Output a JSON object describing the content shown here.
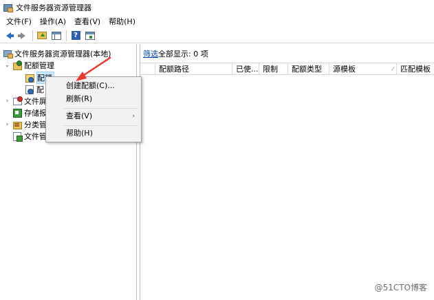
{
  "window": {
    "title": "文件服务器资源管理器"
  },
  "menubar": [
    {
      "label": "文件(F)"
    },
    {
      "label": "操作(A)"
    },
    {
      "label": "查看(V)"
    },
    {
      "label": "帮助(H)"
    }
  ],
  "toolbar": {
    "icons": [
      "back-arrow-icon",
      "forward-arrow-icon",
      "up-folder-icon",
      "show-hide-tree-icon",
      "help-icon",
      "action-pane-icon"
    ]
  },
  "tree": {
    "root": "文件服务器资源管理器(本地)",
    "quota_management": "配额管理",
    "quotas_truncated": "配额",
    "quota_templates_truncated": "配",
    "file_screening_truncated": "文件屏",
    "storage_reports_truncated": "存储报",
    "classification_truncated": "分类管",
    "file_management_truncated": "文件管"
  },
  "list": {
    "filter_link": "筛选",
    "filter_status": "全部显示: 0 项",
    "columns": [
      "配额路径",
      "已使...",
      "限制",
      "配额类型",
      "源模板",
      "匹配模板"
    ]
  },
  "context_menu": {
    "create_quota": "创建配额(C)...",
    "refresh": "刷新(R)",
    "view": "查看(V)",
    "help": "帮助(H)"
  },
  "watermark": "@51CTO博客",
  "colors": {
    "selection": "#cce8ff",
    "annotation_arrow": "#e8392d",
    "link": "#0645ad"
  }
}
